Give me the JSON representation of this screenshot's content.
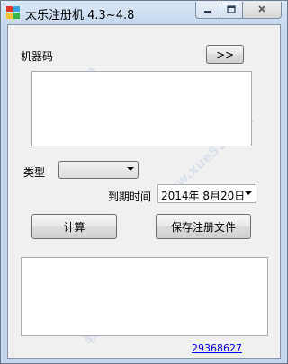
{
  "window": {
    "title": "太乐注册机  4.3~4.8"
  },
  "labels": {
    "machine_code": "机器码",
    "type": "类型",
    "expiry_time": "到期时间"
  },
  "buttons": {
    "expand": ">>",
    "calculate": "计算",
    "save_reg_file": "保存注册文件"
  },
  "inputs": {
    "machine_code_value": "",
    "result_value": ""
  },
  "type_select": {
    "selected": ""
  },
  "expiry_date": {
    "value": "2014年  8月20日"
  },
  "footer": {
    "link": "29368627"
  },
  "watermark": {
    "line1": "软件学堂",
    "line2": "www.xue51.com",
    "line3": "软件学堂"
  },
  "colors": {
    "window_frame": "#c5d7ec",
    "client_bg": "#f0f0f0",
    "link": "#0000ee"
  },
  "icons": {
    "app": "app-icon",
    "minimize": "minimize-icon",
    "maximize": "maximize-icon",
    "close": "close-icon",
    "dropdown": "chevron-down-icon"
  }
}
